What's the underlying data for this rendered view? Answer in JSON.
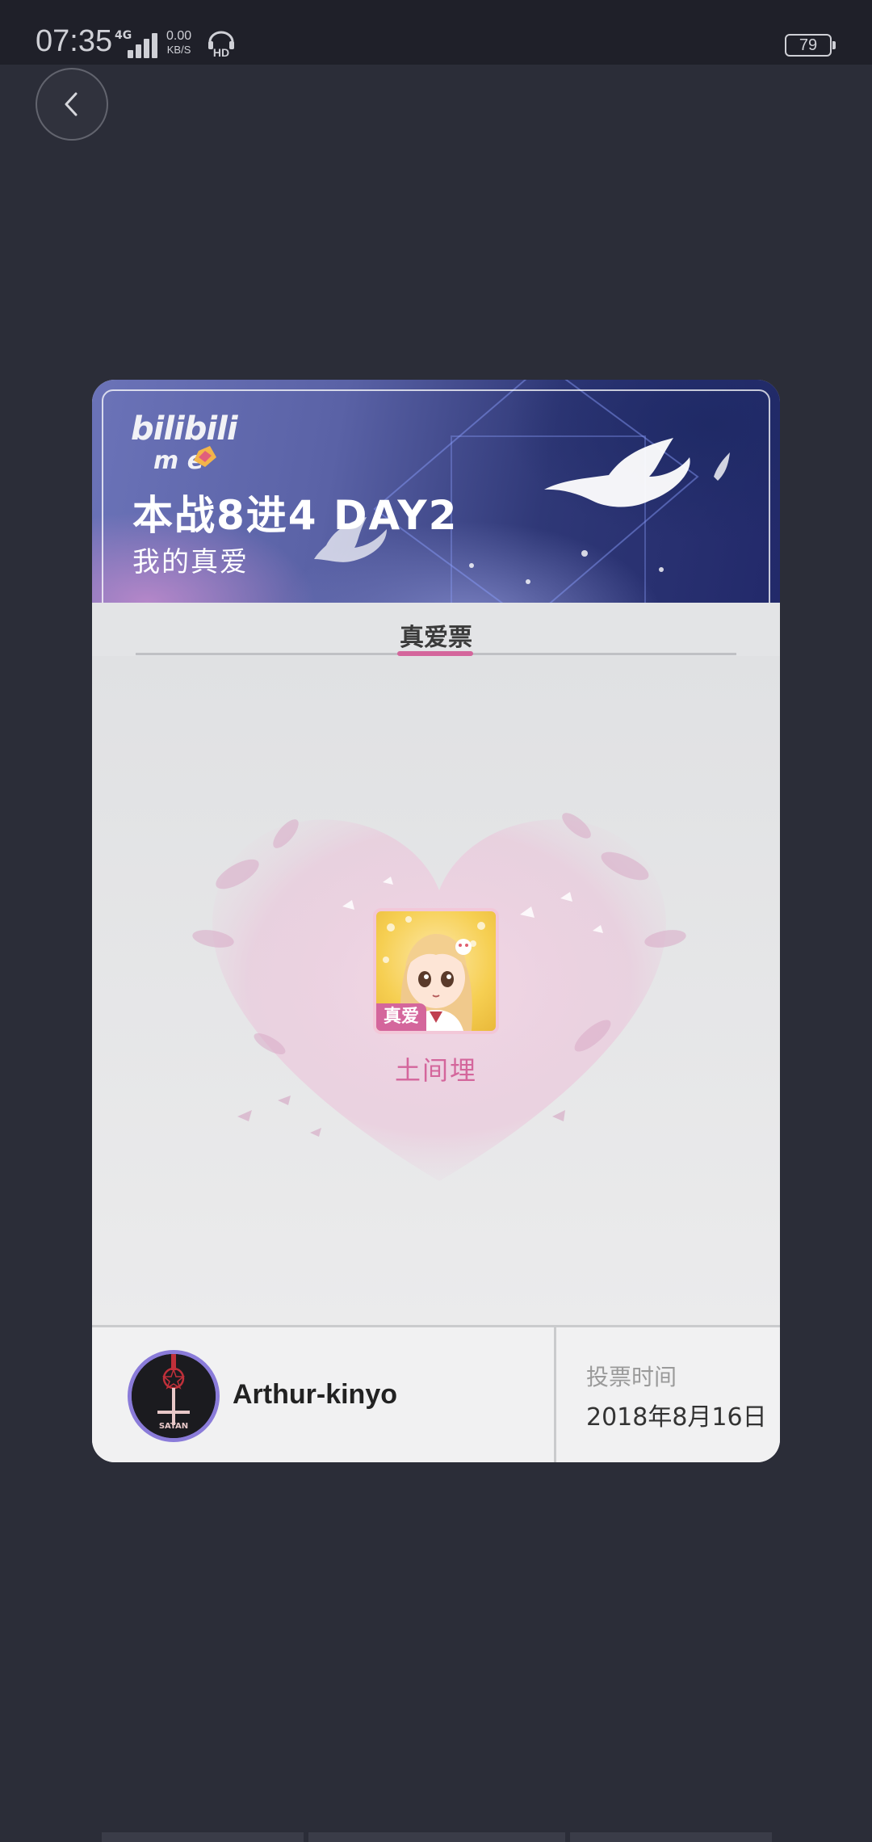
{
  "status_bar": {
    "time": "07:35",
    "network_type": "4G",
    "speed_value": "0.00",
    "speed_unit": "KB/S",
    "battery": "79"
  },
  "navigation": {
    "back_icon": "chevron-left-icon"
  },
  "banner": {
    "logo_icon": "bilibili-moe-logo",
    "title": "本战8进4 DAY2",
    "subtitle": "我的真爱"
  },
  "tabs": [
    {
      "label": "真爱票",
      "active": true
    }
  ],
  "vote": {
    "badge": "真爱",
    "character_name": "土间埋"
  },
  "footer": {
    "username": "Arthur-kinyo",
    "vote_time_label": "投票时间",
    "vote_time_value": "2018年8月16日"
  },
  "colors": {
    "accent_pink": "#d4669c",
    "background": "#2b2d38",
    "avatar_ring": "#8a7bd9"
  }
}
